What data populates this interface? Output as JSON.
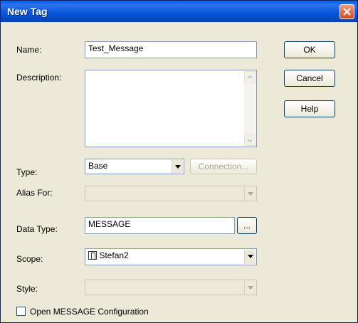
{
  "window": {
    "title": "New Tag"
  },
  "labels": {
    "name": "Name:",
    "description": "Description:",
    "type": "Type:",
    "alias_for": "Alias For:",
    "data_type": "Data Type:",
    "scope": "Scope:",
    "style": "Style:"
  },
  "fields": {
    "name_value": "Test_Message",
    "description_value": "",
    "type_value": "Base",
    "alias_for_value": "",
    "data_type_value": "MESSAGE",
    "scope_value": "Stefan2",
    "style_value": ""
  },
  "buttons": {
    "ok": "OK",
    "cancel": "Cancel",
    "help": "Help",
    "connection": "Connection...",
    "browse": "..."
  },
  "checkbox": {
    "label": "Open MESSAGE Configuration",
    "checked": false
  },
  "icons": {
    "scope_icon": "controller-icon",
    "close": "close-icon"
  }
}
